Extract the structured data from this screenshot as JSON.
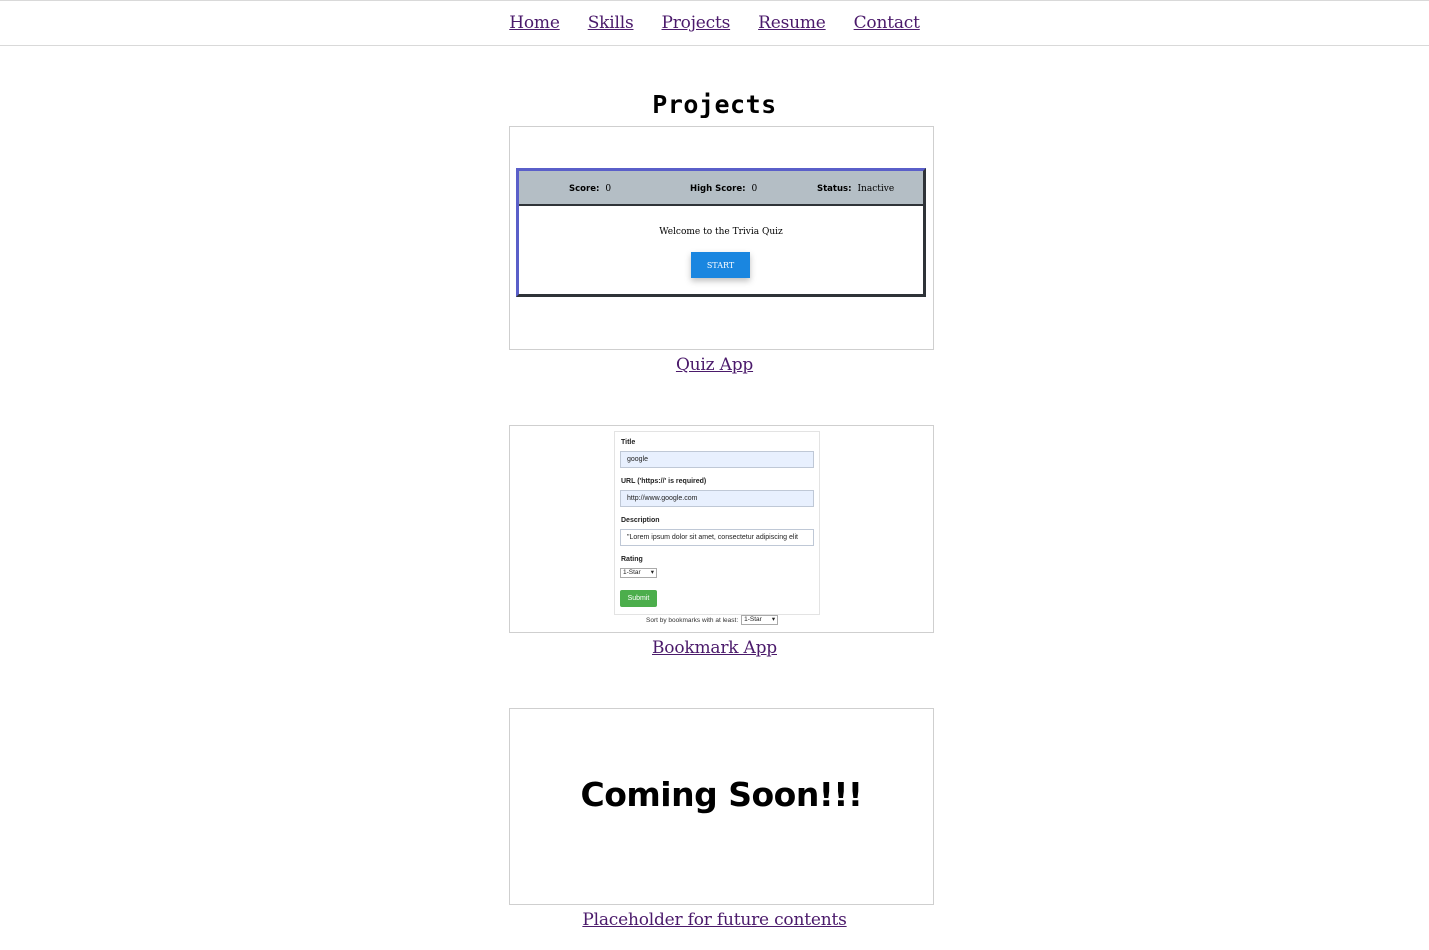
{
  "nav": {
    "items": [
      {
        "label": "Home"
      },
      {
        "label": "Skills"
      },
      {
        "label": "Projects"
      },
      {
        "label": "Resume"
      },
      {
        "label": "Contact"
      }
    ]
  },
  "main": {
    "title": "Projects",
    "projects": [
      {
        "caption": "Quiz App",
        "preview": {
          "score_label": "Score:",
          "score_value": "0",
          "high_score_label": "High Score:",
          "high_score_value": "0",
          "status_label": "Status:",
          "status_value": "Inactive",
          "welcome": "Welcome to the Trivia Quiz",
          "start_label": "START"
        }
      },
      {
        "caption": "Bookmark App",
        "preview": {
          "title_label": "Title",
          "title_value": "google",
          "url_label": "URL ('https://' is required)",
          "url_value": "http://www.google.com",
          "description_label": "Description",
          "description_value": "\"Lorem ipsum dolor sit amet, consectetur adipiscing elit",
          "rating_label": "Rating",
          "rating_value": "1-Star",
          "submit_label": "Submit",
          "sort_label": "Sort by bookmarks with at least:",
          "sort_value": "1-Star"
        }
      },
      {
        "caption": "Placeholder for future contents",
        "preview": {
          "text": "Coming Soon!!!"
        }
      }
    ]
  },
  "colors": {
    "link": "#4b1a6b",
    "quiz_bar": "#b4bec5",
    "start_button": "#1a86e0",
    "submit_button": "#4cae4c"
  }
}
